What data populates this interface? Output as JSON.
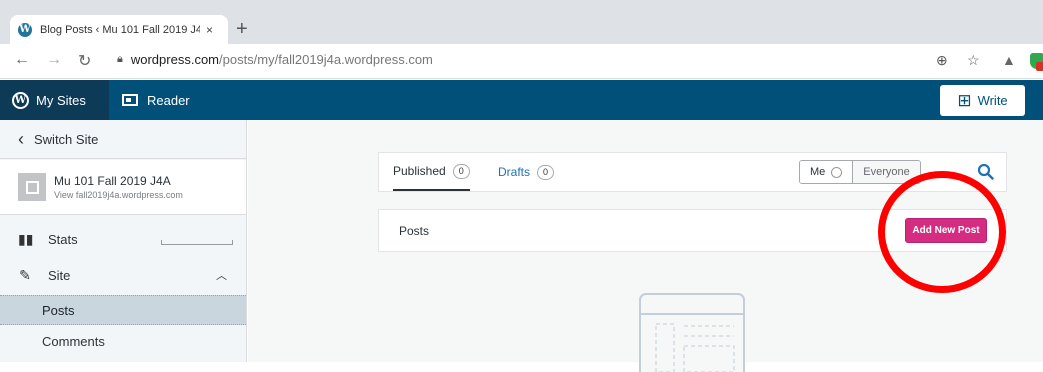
{
  "browser": {
    "tab_title": "Blog Posts ‹ Mu 101 Fall 2019 J4/",
    "tab_close": "×",
    "new_tab": "+",
    "url_domain": "wordpress.com",
    "url_path": "/posts/my/fall2019j4a.wordpress.com"
  },
  "masterbar": {
    "my_sites": "My Sites",
    "reader": "Reader",
    "write": "Write"
  },
  "sidebar": {
    "switch_site": "Switch Site",
    "site_name": "Mu 101 Fall 2019 J4A",
    "site_url": "View fall2019j4a.wordpress.com",
    "stats": "Stats",
    "site": "Site",
    "posts": "Posts",
    "comments": "Comments"
  },
  "main": {
    "tabs": [
      {
        "label": "Published",
        "count": "0"
      },
      {
        "label": "Drafts",
        "count": "0"
      }
    ],
    "author_filter": {
      "me": "Me",
      "everyone": "Everyone"
    },
    "posts_header": "Posts",
    "add_new_post": "Add New Post"
  },
  "colors": {
    "masterbar": "#00507a",
    "add_button": "#d52c82",
    "annotation": "#ff0000"
  }
}
